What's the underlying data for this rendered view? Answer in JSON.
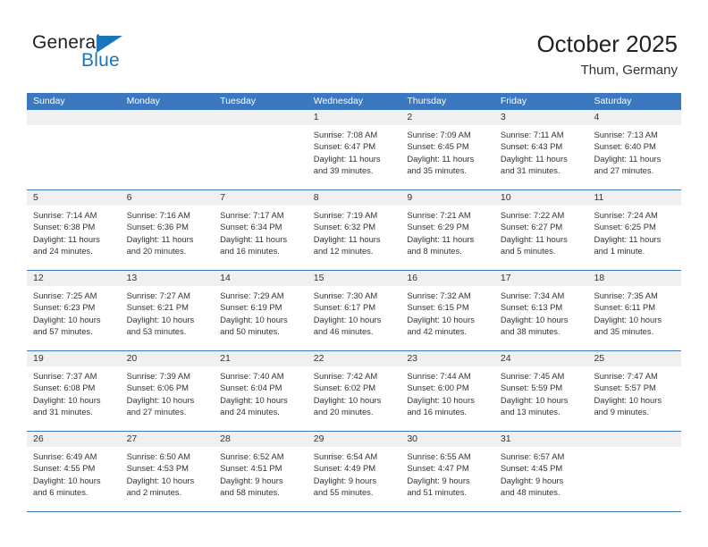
{
  "logo": {
    "word_general": "General",
    "word_blue": "Blue",
    "triangle_color": "#1b75bb",
    "text_color": "#231f20"
  },
  "header": {
    "month_title": "October 2025",
    "location": "Thum, Germany",
    "header_bg": "#3b78bf",
    "daynum_bg": "#f0f0f0"
  },
  "weekdays": [
    "Sunday",
    "Monday",
    "Tuesday",
    "Wednesday",
    "Thursday",
    "Friday",
    "Saturday"
  ],
  "labels": {
    "sunrise_prefix": "Sunrise:",
    "sunset_prefix": "Sunset:",
    "daylight_prefix": "Daylight:"
  },
  "weeks": [
    [
      {
        "day": "",
        "sunrise": "",
        "sunset": "",
        "daylight_1": "",
        "daylight_2": ""
      },
      {
        "day": "",
        "sunrise": "",
        "sunset": "",
        "daylight_1": "",
        "daylight_2": ""
      },
      {
        "day": "",
        "sunrise": "",
        "sunset": "",
        "daylight_1": "",
        "daylight_2": ""
      },
      {
        "day": "1",
        "sunrise": "Sunrise: 7:08 AM",
        "sunset": "Sunset: 6:47 PM",
        "daylight_1": "Daylight: 11 hours",
        "daylight_2": "and 39 minutes."
      },
      {
        "day": "2",
        "sunrise": "Sunrise: 7:09 AM",
        "sunset": "Sunset: 6:45 PM",
        "daylight_1": "Daylight: 11 hours",
        "daylight_2": "and 35 minutes."
      },
      {
        "day": "3",
        "sunrise": "Sunrise: 7:11 AM",
        "sunset": "Sunset: 6:43 PM",
        "daylight_1": "Daylight: 11 hours",
        "daylight_2": "and 31 minutes."
      },
      {
        "day": "4",
        "sunrise": "Sunrise: 7:13 AM",
        "sunset": "Sunset: 6:40 PM",
        "daylight_1": "Daylight: 11 hours",
        "daylight_2": "and 27 minutes."
      }
    ],
    [
      {
        "day": "5",
        "sunrise": "Sunrise: 7:14 AM",
        "sunset": "Sunset: 6:38 PM",
        "daylight_1": "Daylight: 11 hours",
        "daylight_2": "and 24 minutes."
      },
      {
        "day": "6",
        "sunrise": "Sunrise: 7:16 AM",
        "sunset": "Sunset: 6:36 PM",
        "daylight_1": "Daylight: 11 hours",
        "daylight_2": "and 20 minutes."
      },
      {
        "day": "7",
        "sunrise": "Sunrise: 7:17 AM",
        "sunset": "Sunset: 6:34 PM",
        "daylight_1": "Daylight: 11 hours",
        "daylight_2": "and 16 minutes."
      },
      {
        "day": "8",
        "sunrise": "Sunrise: 7:19 AM",
        "sunset": "Sunset: 6:32 PM",
        "daylight_1": "Daylight: 11 hours",
        "daylight_2": "and 12 minutes."
      },
      {
        "day": "9",
        "sunrise": "Sunrise: 7:21 AM",
        "sunset": "Sunset: 6:29 PM",
        "daylight_1": "Daylight: 11 hours",
        "daylight_2": "and 8 minutes."
      },
      {
        "day": "10",
        "sunrise": "Sunrise: 7:22 AM",
        "sunset": "Sunset: 6:27 PM",
        "daylight_1": "Daylight: 11 hours",
        "daylight_2": "and 5 minutes."
      },
      {
        "day": "11",
        "sunrise": "Sunrise: 7:24 AM",
        "sunset": "Sunset: 6:25 PM",
        "daylight_1": "Daylight: 11 hours",
        "daylight_2": "and 1 minute."
      }
    ],
    [
      {
        "day": "12",
        "sunrise": "Sunrise: 7:25 AM",
        "sunset": "Sunset: 6:23 PM",
        "daylight_1": "Daylight: 10 hours",
        "daylight_2": "and 57 minutes."
      },
      {
        "day": "13",
        "sunrise": "Sunrise: 7:27 AM",
        "sunset": "Sunset: 6:21 PM",
        "daylight_1": "Daylight: 10 hours",
        "daylight_2": "and 53 minutes."
      },
      {
        "day": "14",
        "sunrise": "Sunrise: 7:29 AM",
        "sunset": "Sunset: 6:19 PM",
        "daylight_1": "Daylight: 10 hours",
        "daylight_2": "and 50 minutes."
      },
      {
        "day": "15",
        "sunrise": "Sunrise: 7:30 AM",
        "sunset": "Sunset: 6:17 PM",
        "daylight_1": "Daylight: 10 hours",
        "daylight_2": "and 46 minutes."
      },
      {
        "day": "16",
        "sunrise": "Sunrise: 7:32 AM",
        "sunset": "Sunset: 6:15 PM",
        "daylight_1": "Daylight: 10 hours",
        "daylight_2": "and 42 minutes."
      },
      {
        "day": "17",
        "sunrise": "Sunrise: 7:34 AM",
        "sunset": "Sunset: 6:13 PM",
        "daylight_1": "Daylight: 10 hours",
        "daylight_2": "and 38 minutes."
      },
      {
        "day": "18",
        "sunrise": "Sunrise: 7:35 AM",
        "sunset": "Sunset: 6:11 PM",
        "daylight_1": "Daylight: 10 hours",
        "daylight_2": "and 35 minutes."
      }
    ],
    [
      {
        "day": "19",
        "sunrise": "Sunrise: 7:37 AM",
        "sunset": "Sunset: 6:08 PM",
        "daylight_1": "Daylight: 10 hours",
        "daylight_2": "and 31 minutes."
      },
      {
        "day": "20",
        "sunrise": "Sunrise: 7:39 AM",
        "sunset": "Sunset: 6:06 PM",
        "daylight_1": "Daylight: 10 hours",
        "daylight_2": "and 27 minutes."
      },
      {
        "day": "21",
        "sunrise": "Sunrise: 7:40 AM",
        "sunset": "Sunset: 6:04 PM",
        "daylight_1": "Daylight: 10 hours",
        "daylight_2": "and 24 minutes."
      },
      {
        "day": "22",
        "sunrise": "Sunrise: 7:42 AM",
        "sunset": "Sunset: 6:02 PM",
        "daylight_1": "Daylight: 10 hours",
        "daylight_2": "and 20 minutes."
      },
      {
        "day": "23",
        "sunrise": "Sunrise: 7:44 AM",
        "sunset": "Sunset: 6:00 PM",
        "daylight_1": "Daylight: 10 hours",
        "daylight_2": "and 16 minutes."
      },
      {
        "day": "24",
        "sunrise": "Sunrise: 7:45 AM",
        "sunset": "Sunset: 5:59 PM",
        "daylight_1": "Daylight: 10 hours",
        "daylight_2": "and 13 minutes."
      },
      {
        "day": "25",
        "sunrise": "Sunrise: 7:47 AM",
        "sunset": "Sunset: 5:57 PM",
        "daylight_1": "Daylight: 10 hours",
        "daylight_2": "and 9 minutes."
      }
    ],
    [
      {
        "day": "26",
        "sunrise": "Sunrise: 6:49 AM",
        "sunset": "Sunset: 4:55 PM",
        "daylight_1": "Daylight: 10 hours",
        "daylight_2": "and 6 minutes."
      },
      {
        "day": "27",
        "sunrise": "Sunrise: 6:50 AM",
        "sunset": "Sunset: 4:53 PM",
        "daylight_1": "Daylight: 10 hours",
        "daylight_2": "and 2 minutes."
      },
      {
        "day": "28",
        "sunrise": "Sunrise: 6:52 AM",
        "sunset": "Sunset: 4:51 PM",
        "daylight_1": "Daylight: 9 hours",
        "daylight_2": "and 58 minutes."
      },
      {
        "day": "29",
        "sunrise": "Sunrise: 6:54 AM",
        "sunset": "Sunset: 4:49 PM",
        "daylight_1": "Daylight: 9 hours",
        "daylight_2": "and 55 minutes."
      },
      {
        "day": "30",
        "sunrise": "Sunrise: 6:55 AM",
        "sunset": "Sunset: 4:47 PM",
        "daylight_1": "Daylight: 9 hours",
        "daylight_2": "and 51 minutes."
      },
      {
        "day": "31",
        "sunrise": "Sunrise: 6:57 AM",
        "sunset": "Sunset: 4:45 PM",
        "daylight_1": "Daylight: 9 hours",
        "daylight_2": "and 48 minutes."
      },
      {
        "day": "",
        "sunrise": "",
        "sunset": "",
        "daylight_1": "",
        "daylight_2": ""
      }
    ]
  ]
}
